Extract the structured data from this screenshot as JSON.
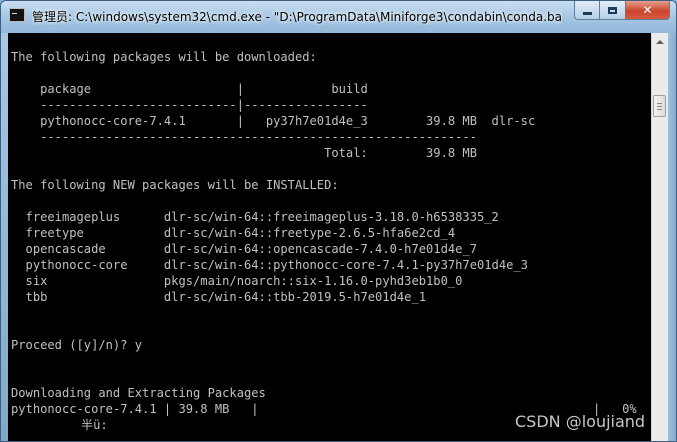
{
  "window": {
    "title": "管理员: C:\\windows\\system32\\cmd.exe - \"D:\\ProgramData\\Miniforge3\\condabin\\conda.bat\""
  },
  "console": {
    "lines": [
      "The following packages will be downloaded:",
      "",
      "    package                    |            build",
      "    ---------------------------|-----------------",
      "    pythonocc-core-7.4.1       |   py37h7e01d4e_3        39.8 MB  dlr-sc",
      "    ------------------------------------------------------------",
      "                                           Total:        39.8 MB",
      "",
      "The following NEW packages will be INSTALLED:",
      "",
      "  freeimageplus      dlr-sc/win-64::freeimageplus-3.18.0-h6538335_2",
      "  freetype           dlr-sc/win-64::freetype-2.6.5-hfa6e2cd_4",
      "  opencascade        dlr-sc/win-64::opencascade-7.4.0-h7e01d4e_7",
      "  pythonocc-core     dlr-sc/win-64::pythonocc-core-7.4.1-py37h7e01d4e_3",
      "  six                pkgs/main/noarch::six-1.16.0-pyhd3eb1b0_0",
      "  tbb                dlr-sc/win-64::tbb-2019.5-h7e01d4e_1",
      "",
      "",
      "Proceed ([y]/n)? y",
      "",
      "",
      "Downloading and Extracting Packages",
      "pythonocc-core-7.4.1 | 39.8 MB   |"
    ],
    "progress_tail": "|   0%",
    "ime_line": "半ü:"
  },
  "watermark": "CSDN @loujiand"
}
